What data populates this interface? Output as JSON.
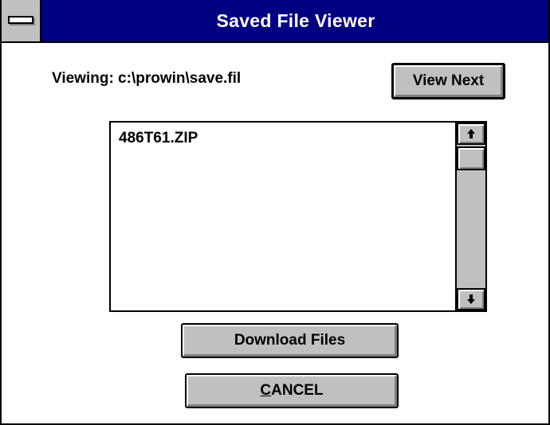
{
  "window": {
    "title": "Saved File Viewer"
  },
  "viewing": {
    "label": "Viewing:  c:\\prowin\\save.fil"
  },
  "buttons": {
    "view_next": "View Next",
    "download": "Download Files",
    "cancel_first": "C",
    "cancel_rest": "ANCEL"
  },
  "file_list": {
    "items": [
      "486T61.ZIP"
    ]
  },
  "icons": {
    "system_menu": "system-menu-icon",
    "scroll_up": "scroll-up-arrow-icon",
    "scroll_down": "scroll-down-arrow-icon"
  },
  "colors": {
    "titlebar": "#000080",
    "button_face": "#c0c0c0",
    "window_bg": "#ffffff"
  }
}
